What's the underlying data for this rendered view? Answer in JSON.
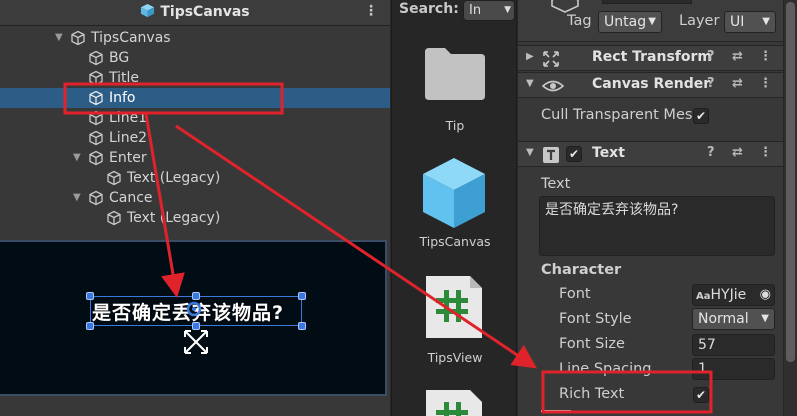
{
  "hierarchy": {
    "title": "TipsCanvas",
    "menu_icon": "kebab-menu-icon",
    "items": [
      {
        "label": "TipsCanvas",
        "expanded": true
      },
      {
        "label": "BG"
      },
      {
        "label": "Title"
      },
      {
        "label": "Info",
        "selected": true
      },
      {
        "label": "Line1"
      },
      {
        "label": "Line2"
      },
      {
        "label": "Enter",
        "expanded": true
      },
      {
        "label": "Text (Legacy)"
      },
      {
        "label": "Cance",
        "expanded": true
      },
      {
        "label": "Text (Legacy)"
      }
    ]
  },
  "scene": {
    "info_text": "是否确定丢弃该物品?"
  },
  "project": {
    "search_label": "Search:",
    "search_value": "In",
    "assets": [
      {
        "label": "Tip",
        "icon": "folder-icon"
      },
      {
        "label": "TipsCanvas",
        "icon": "prefab-cube-icon"
      },
      {
        "label": "TipsView",
        "icon": "csharp-script-icon"
      }
    ]
  },
  "inspector": {
    "tag_label": "Tag",
    "tag_value": "Untag",
    "layer_label": "Layer",
    "layer_value": "UI",
    "components": {
      "rect_transform": "Rect Transform",
      "canvas_renderer": "Canvas Render",
      "text": "Text"
    },
    "cull_label": "Cull Transparent Mes",
    "text_label": "Text",
    "text_value": "是否确定丢弃该物品?",
    "character_header": "Character",
    "font_label": "Font",
    "font_value": "HYJie",
    "font_style_label": "Font Style",
    "font_style_value": "Normal",
    "font_size_label": "Font Size",
    "font_size_value": "57",
    "line_spacing_label": "Line Spacing",
    "line_spacing_value": "1",
    "rich_text_label": "Rich Text"
  },
  "colors": {
    "annotation_red": "#e0232b",
    "selection_blue": "#2c5d87",
    "prefab_blue": "#6dc9f3"
  }
}
